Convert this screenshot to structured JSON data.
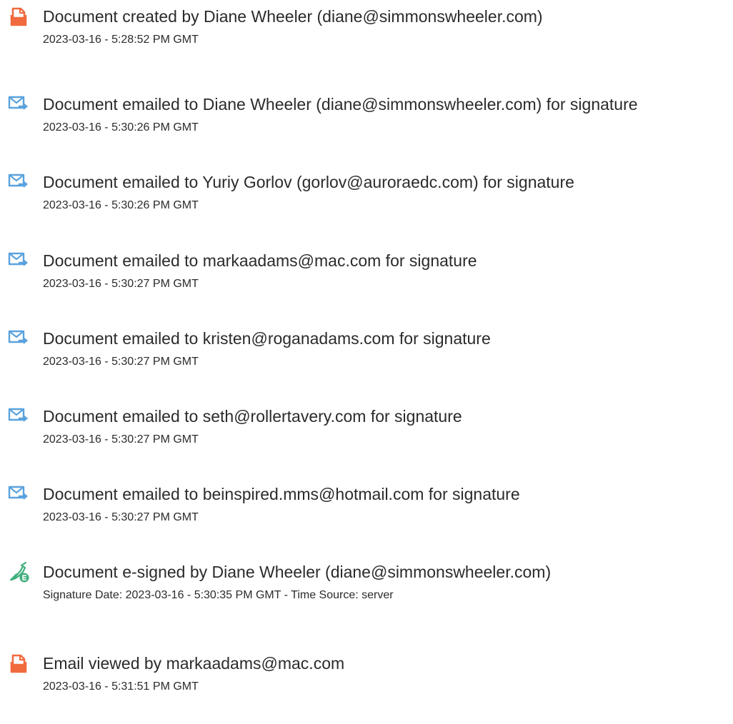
{
  "colors": {
    "document_icon": "#f06a3e",
    "email_icon": "#5aa2dd",
    "esign_icon": "#3fae7b",
    "text": "#2b2b2b"
  },
  "events": [
    {
      "icon": "document-icon",
      "title": "Document created by Diane Wheeler (diane@simmonswheeler.com)",
      "detail": "2023-03-16 - 5:28:52 PM GMT"
    },
    {
      "icon": "email-sent-icon",
      "title": "Document emailed to Diane Wheeler (diane@simmonswheeler.com) for signature",
      "detail": "2023-03-16 - 5:30:26 PM GMT"
    },
    {
      "icon": "email-sent-icon",
      "title": "Document emailed to Yuriy Gorlov (gorlov@auroraedc.com) for signature",
      "detail": "2023-03-16 - 5:30:26 PM GMT"
    },
    {
      "icon": "email-sent-icon",
      "title": "Document emailed to markaadams@mac.com for signature",
      "detail": "2023-03-16 - 5:30:27 PM GMT"
    },
    {
      "icon": "email-sent-icon",
      "title": "Document emailed to kristen@roganadams.com for signature",
      "detail": "2023-03-16 - 5:30:27 PM GMT"
    },
    {
      "icon": "email-sent-icon",
      "title": "Document emailed to seth@rollertavery.com for signature",
      "detail": "2023-03-16 - 5:30:27 PM GMT"
    },
    {
      "icon": "email-sent-icon",
      "title": "Document emailed to beinspired.mms@hotmail.com for signature",
      "detail": "2023-03-16 - 5:30:27 PM GMT"
    },
    {
      "icon": "esign-pen-icon",
      "title": "Document e-signed by Diane Wheeler (diane@simmonswheeler.com)",
      "detail": "Signature Date: 2023-03-16 - 5:30:35 PM GMT - Time Source: server"
    },
    {
      "icon": "document-icon",
      "title": "Email viewed by markaadams@mac.com",
      "detail": "2023-03-16 - 5:31:51 PM GMT"
    }
  ]
}
